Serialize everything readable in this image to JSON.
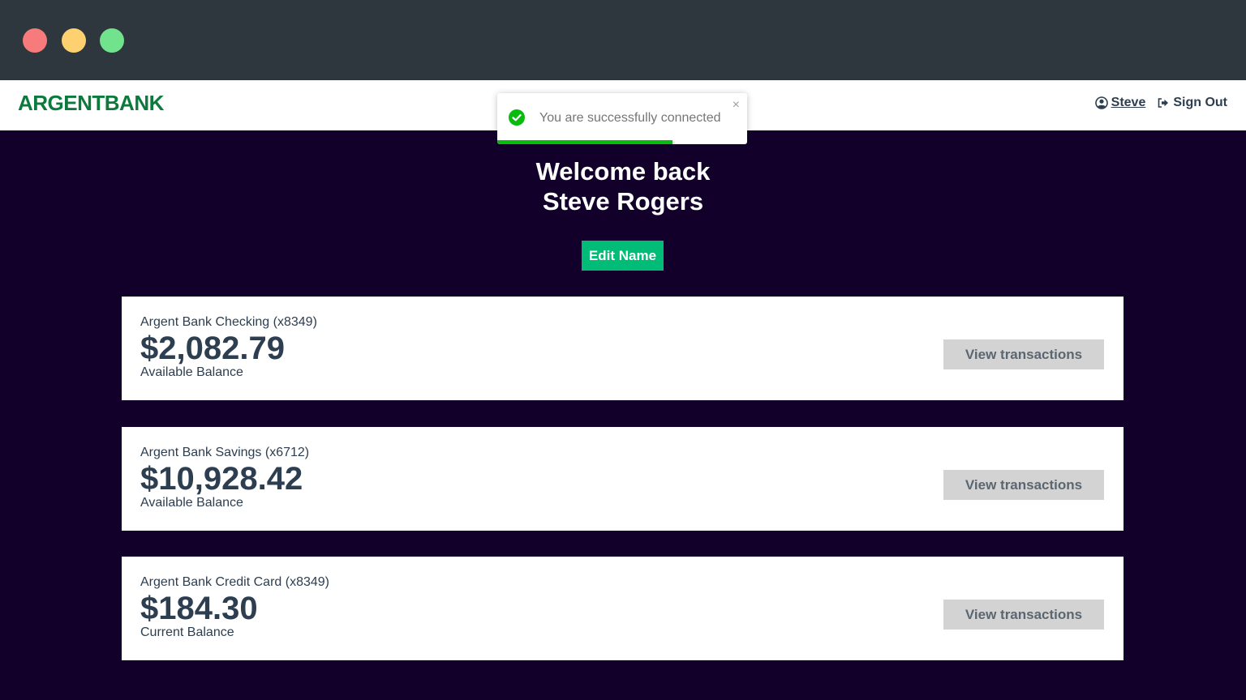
{
  "header": {
    "logo_part1": "ARGENT",
    "logo_part2": "BANK",
    "user_label": "Steve",
    "signout_label": "Sign Out"
  },
  "toast": {
    "message": "You are successfully connected",
    "close_glyph": "×",
    "progress_fraction": 0.7
  },
  "welcome": {
    "line1": "Welcome back",
    "line2": "Steve Rogers",
    "edit_label": "Edit Name"
  },
  "accounts": [
    {
      "title": "Argent Bank Checking (x8349)",
      "amount": "$2,082.79",
      "description": "Available Balance",
      "button": "View transactions"
    },
    {
      "title": "Argent Bank Savings (x6712)",
      "amount": "$10,928.42",
      "description": "Available Balance",
      "button": "View transactions"
    },
    {
      "title": "Argent Bank Credit Card (x8349)",
      "amount": "$184.30",
      "description": "Current Balance",
      "button": "View transactions"
    }
  ],
  "colors": {
    "brand_green": "#00bc77",
    "background": "#12002b",
    "toast_success": "#07bc0c"
  }
}
